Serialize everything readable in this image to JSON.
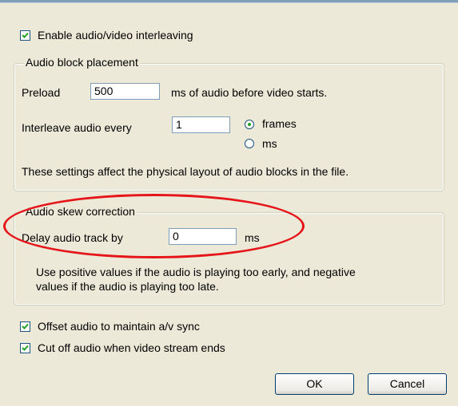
{
  "options": {
    "enable_interleave_label": "Enable audio/video interleaving",
    "enable_interleave_checked": true,
    "offset_audio_label": "Offset audio to maintain a/v sync",
    "offset_audio_checked": true,
    "cutoff_audio_label": "Cut off audio when video stream ends",
    "cutoff_audio_checked": true
  },
  "placement": {
    "legend": "Audio block placement",
    "preload_label": "Preload",
    "preload_value": "500",
    "preload_suffix": "ms of audio before video starts.",
    "interleave_label": "Interleave audio every",
    "interleave_value": "1",
    "unit_frames": "frames",
    "unit_ms": "ms",
    "selected_unit": "frames",
    "note": "These settings affect the physical layout of audio blocks in the file."
  },
  "skew": {
    "legend": "Audio skew correction",
    "delay_label": "Delay audio track by",
    "delay_value": "0",
    "delay_unit": "ms",
    "help_line1": "Use positive values if the audio is playing too early, and negative",
    "help_line2": "values if the audio is playing too late."
  },
  "buttons": {
    "ok": "OK",
    "cancel": "Cancel"
  },
  "colors": {
    "dialog_bg": "#ece9d8",
    "highlight_ellipse": "#e5151a",
    "radio_dot": "#21a121"
  }
}
